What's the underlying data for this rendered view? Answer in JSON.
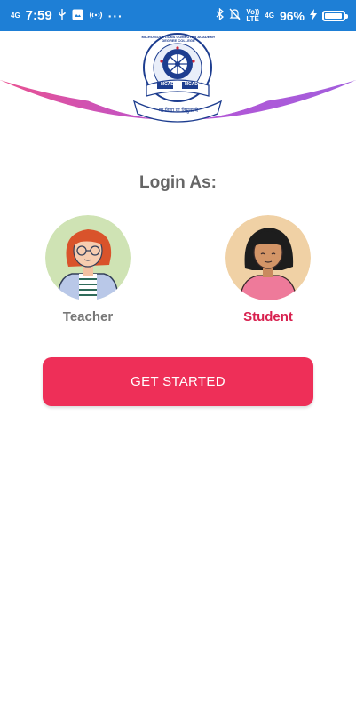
{
  "status_bar": {
    "time": "7:59",
    "network_left": "4G",
    "network_right_top": "Vo))",
    "network_right_bottom": "LTE",
    "network_right_4g": "4G",
    "battery": "96%",
    "battery_level": 0.96,
    "icons": [
      "usb-icon",
      "photo-icon",
      "nfc-icon",
      "more-dots",
      "bluetooth-icon",
      "mute-icon",
      "charging-icon"
    ]
  },
  "header": {
    "logo_text_top": "MICRO SOLUTIONS COMPUTER ACADEMY DEGREE COLLEGE",
    "logo_text_badges": [
      "MCADC",
      "MCADC"
    ],
    "logo_text_bottom": "मा विद्या या विमुक्तये"
  },
  "login": {
    "title": "Login As:",
    "roles": [
      {
        "label": "Teacher",
        "selected": false
      },
      {
        "label": "Student",
        "selected": true
      }
    ],
    "button_label": "GET STARTED"
  },
  "colors": {
    "status_bar": "#1e7fd6",
    "accent": "#ee2f58",
    "title_gray": "#666666",
    "unselected": "#777777",
    "selected": "#d8214f",
    "arc_gradient": [
      "#e9488a",
      "#b34bd2",
      "#9d56db"
    ],
    "teacher_bg": "#cfe3b4",
    "student_bg": "#f0d1a5"
  }
}
